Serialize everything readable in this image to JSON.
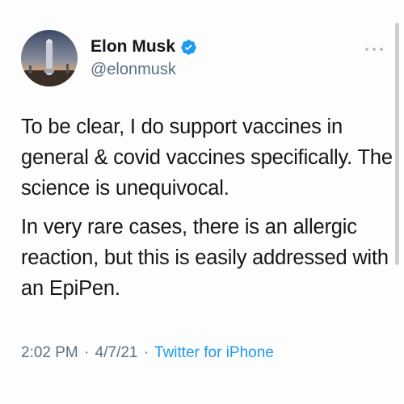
{
  "tweet": {
    "author": {
      "display_name": "Elon Musk",
      "handle": "@elonmusk",
      "verified": true,
      "avatar_icon": "starship-avatar"
    },
    "text": {
      "paragraph_1": "To be clear, I do support vaccines in general & covid vaccines specifically. The science is unequivocal.",
      "paragraph_2": "In very rare cases, there is an allergic reaction, but this is easily addressed with an EpiPen."
    },
    "meta": {
      "time": "2:02 PM",
      "separator": "·",
      "date": "4/7/21",
      "source": "Twitter for iPhone"
    },
    "more_icon": "more-options-icon"
  },
  "colors": {
    "verified_blue": "#1d9bf0",
    "secondary_text": "#5b7083",
    "link": "#1d9bf0",
    "primary_text": "#14171a"
  }
}
